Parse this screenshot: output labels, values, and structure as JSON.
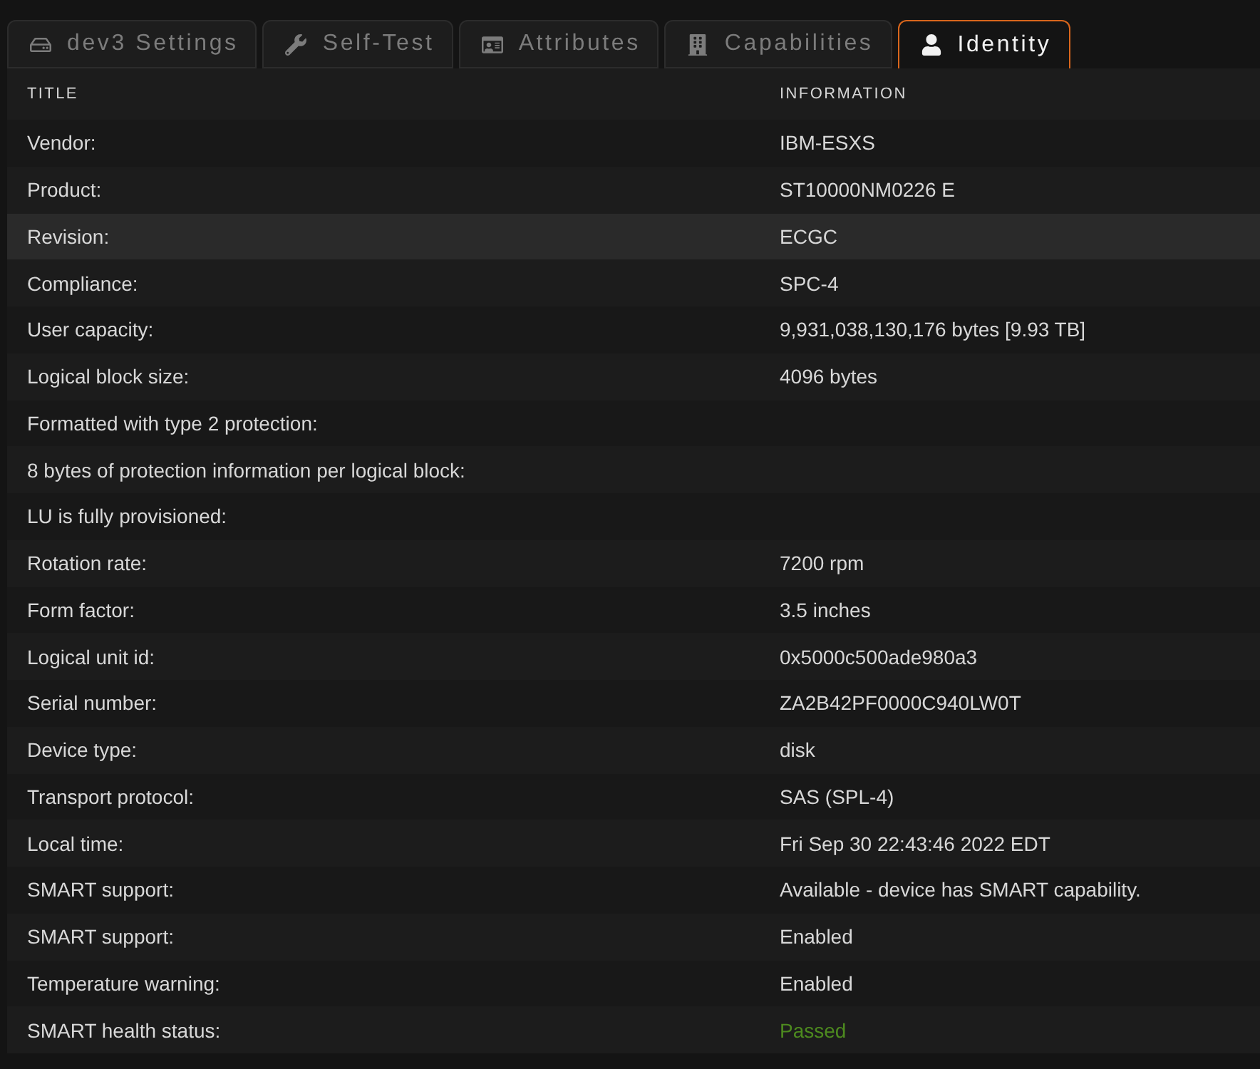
{
  "tabs": [
    {
      "label": "dev3 Settings",
      "selected": false
    },
    {
      "label": "Self-Test",
      "selected": false
    },
    {
      "label": "Attributes",
      "selected": false
    },
    {
      "label": "Capabilities",
      "selected": false
    },
    {
      "label": "Identity",
      "selected": true
    }
  ],
  "table": {
    "columns": [
      "TITLE",
      "INFORMATION"
    ],
    "rows": [
      {
        "title": "Vendor:",
        "value": {
          "text": "IBM-ESXS",
          "kind": "text"
        },
        "highlighted": false
      },
      {
        "title": "Product:",
        "value": {
          "text": "ST10000NM0226 E",
          "kind": "text"
        },
        "highlighted": false
      },
      {
        "title": "Revision:",
        "value": {
          "text": "ECGC",
          "kind": "text"
        },
        "highlighted": true
      },
      {
        "title": "Compliance:",
        "value": {
          "text": "SPC-4",
          "kind": "text"
        },
        "highlighted": false
      },
      {
        "title": "User capacity:",
        "value": {
          "text": "9,931,038,130,176 bytes [9.93 TB]",
          "kind": "text"
        },
        "highlighted": false
      },
      {
        "title": "Logical block size:",
        "value": {
          "text": "4096 bytes",
          "kind": "text"
        },
        "highlighted": false
      },
      {
        "title": "Formatted with type 2 protection:",
        "highlighted": false
      },
      {
        "title": "8 bytes of protection information per logical block:",
        "highlighted": false
      },
      {
        "title": "LU is fully provisioned:",
        "highlighted": false
      },
      {
        "title": "Rotation rate:",
        "value": {
          "text": "7200 rpm",
          "kind": "text"
        },
        "highlighted": false
      },
      {
        "title": "Form factor:",
        "value": {
          "text": "3.5 inches",
          "kind": "text"
        },
        "highlighted": false
      },
      {
        "title": "Logical unit id:",
        "value": {
          "text": "0x5000c500ade980a3",
          "kind": "text"
        },
        "highlighted": false
      },
      {
        "title": "Serial number:",
        "value": {
          "text": "ZA2B42PF0000C940LW0T",
          "kind": "text"
        },
        "highlighted": false
      },
      {
        "title": "Device type:",
        "value": {
          "text": "disk",
          "kind": "text"
        },
        "highlighted": false
      },
      {
        "title": "Transport protocol:",
        "value": {
          "text": "SAS (SPL-4)",
          "kind": "text"
        },
        "highlighted": false
      },
      {
        "title": "Local time:",
        "value": {
          "text": "Fri Sep 30 22:43:46 2022 EDT",
          "kind": "text"
        },
        "highlighted": false
      },
      {
        "title": "SMART support:",
        "value": {
          "text": "Available - device has SMART capability.",
          "kind": "text"
        },
        "highlighted": false
      },
      {
        "title": "SMART support:",
        "value": {
          "text": "Enabled",
          "kind": "text"
        },
        "highlighted": false
      },
      {
        "title": "Temperature warning:",
        "value": {
          "text": "Enabled",
          "kind": "text"
        },
        "highlighted": false
      },
      {
        "title": "SMART health status:",
        "value": {
          "text": "Passed",
          "kind": "status"
        },
        "highlighted": false
      }
    ]
  }
}
